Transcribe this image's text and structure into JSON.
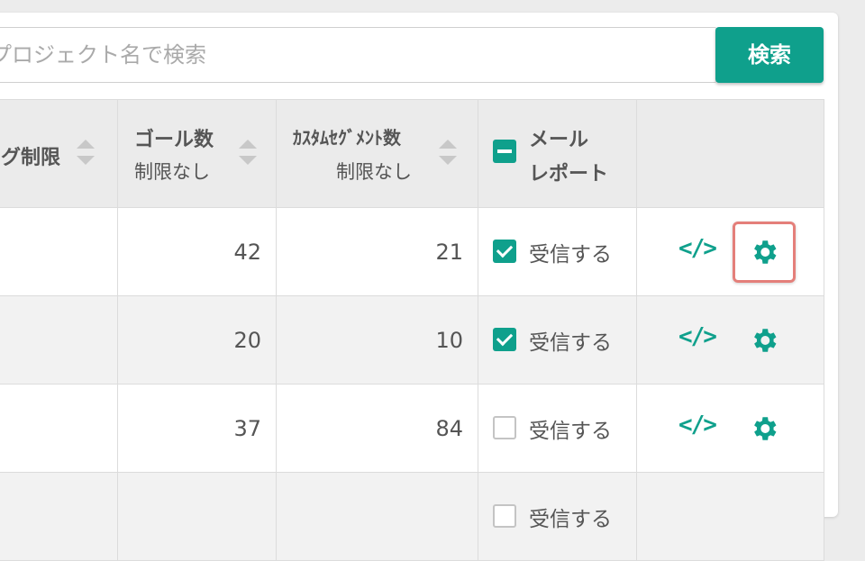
{
  "search": {
    "placeholder": "プロジェクト名で検索",
    "button_label": "検索"
  },
  "columns": [
    {
      "label": "グ制限",
      "sub": ""
    },
    {
      "label": "ゴール数",
      "sub": "制限なし"
    },
    {
      "label": "ｶｽﾀﾑｾｸﾞﾒﾝﾄ数",
      "sub": "制限なし"
    },
    {
      "label_line1": "メール",
      "label_line2": "レポート"
    },
    {
      "label": ""
    }
  ],
  "rows": [
    {
      "goals": "42",
      "segments": "21",
      "mail_checked": true,
      "mail_label": "受信する"
    },
    {
      "goals": "20",
      "segments": "10",
      "mail_checked": true,
      "mail_label": "受信する"
    },
    {
      "goals": "37",
      "segments": "84",
      "mail_checked": false,
      "mail_label": "受信する"
    }
  ],
  "partial_row": {
    "mail_label": "受信する"
  },
  "colors": {
    "accent": "#0fa08c",
    "highlight": "#e47f7a"
  },
  "icons": {
    "code": "code-icon",
    "settings": "gear-icon"
  }
}
